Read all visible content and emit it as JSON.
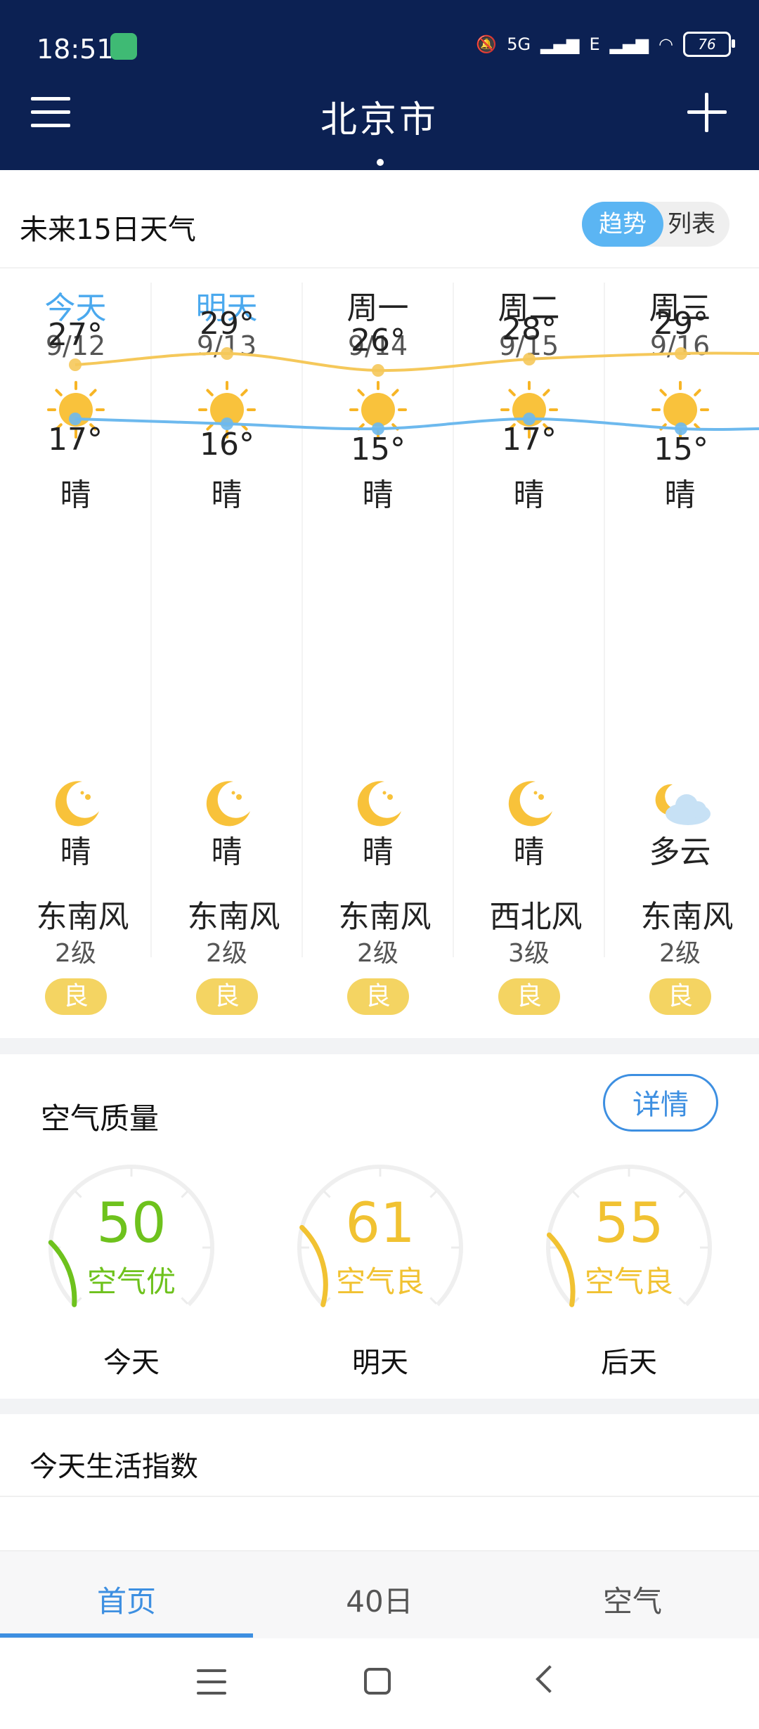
{
  "status": {
    "time": "18:51",
    "battery": "76",
    "net1": "5G",
    "net2": "E"
  },
  "header": {
    "city": "北京市"
  },
  "forecast": {
    "title": "未来15日天气",
    "toggle": {
      "on": "趋势",
      "off": "列表"
    },
    "days": [
      {
        "day": "今天",
        "date": "9/12",
        "day_wx": "晴",
        "high": "27°",
        "low": "17°",
        "night_wx": "晴",
        "wind": "东南风",
        "level": "2级",
        "aqi": "良"
      },
      {
        "day": "明天",
        "date": "9/13",
        "day_wx": "晴",
        "high": "29°",
        "low": "16°",
        "night_wx": "晴",
        "wind": "东南风",
        "level": "2级",
        "aqi": "良"
      },
      {
        "day": "周一",
        "date": "9/14",
        "day_wx": "晴",
        "high": "26°",
        "low": "15°",
        "night_wx": "晴",
        "wind": "东南风",
        "level": "2级",
        "aqi": "良"
      },
      {
        "day": "周二",
        "date": "9/15",
        "day_wx": "晴",
        "high": "28°",
        "low": "17°",
        "night_wx": "晴",
        "wind": "西北风",
        "level": "3级",
        "aqi": "良"
      },
      {
        "day": "周三",
        "date": "9/16",
        "day_wx": "晴",
        "high": "29°",
        "low": "15°",
        "night_wx": "多云",
        "wind": "东南风",
        "level": "2级",
        "aqi": "良"
      }
    ],
    "colors": {
      "high_line": "#f5c85a",
      "low_line": "#6db9ee"
    }
  },
  "chart_data": {
    "type": "line",
    "categories": [
      "9/12",
      "9/13",
      "9/14",
      "9/15",
      "9/16"
    ],
    "series": [
      {
        "values": [
          27,
          29,
          26,
          28,
          29
        ]
      },
      {
        "values": [
          17,
          16,
          15,
          17,
          15
        ]
      }
    ]
  },
  "air": {
    "title": "空气质量",
    "detail_label": "详情",
    "gauges": [
      {
        "value": "50",
        "label": "空气优",
        "day": "今天",
        "color": "#6ec21d",
        "fraction": 0.18
      },
      {
        "value": "61",
        "label": "空气良",
        "day": "明天",
        "color": "#f1c232",
        "fraction": 0.22
      },
      {
        "value": "55",
        "label": "空气良",
        "day": "后天",
        "color": "#f1c232",
        "fraction": 0.2
      }
    ]
  },
  "life": {
    "title": "今天生活指数"
  },
  "tabs": {
    "home": "首页",
    "forty": "40日",
    "air": "空气"
  }
}
